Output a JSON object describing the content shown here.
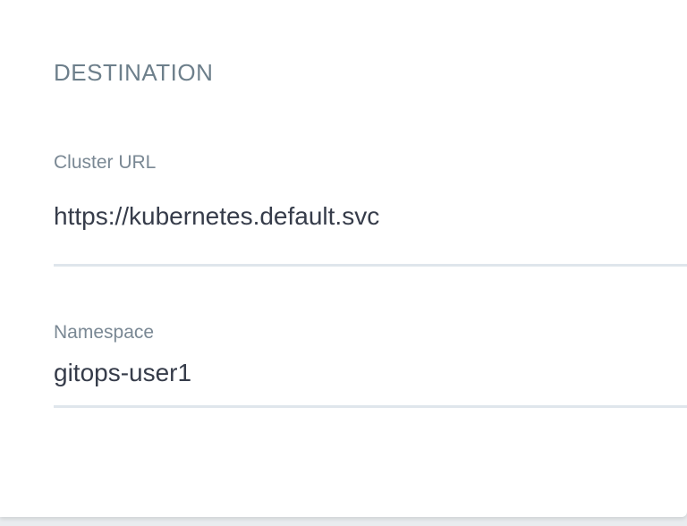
{
  "destination": {
    "title": "DESTINATION",
    "cluster_url": {
      "label": "Cluster URL",
      "value": "https://kubernetes.default.svc"
    },
    "namespace": {
      "label": "Namespace",
      "value": "gitops-user1"
    }
  }
}
